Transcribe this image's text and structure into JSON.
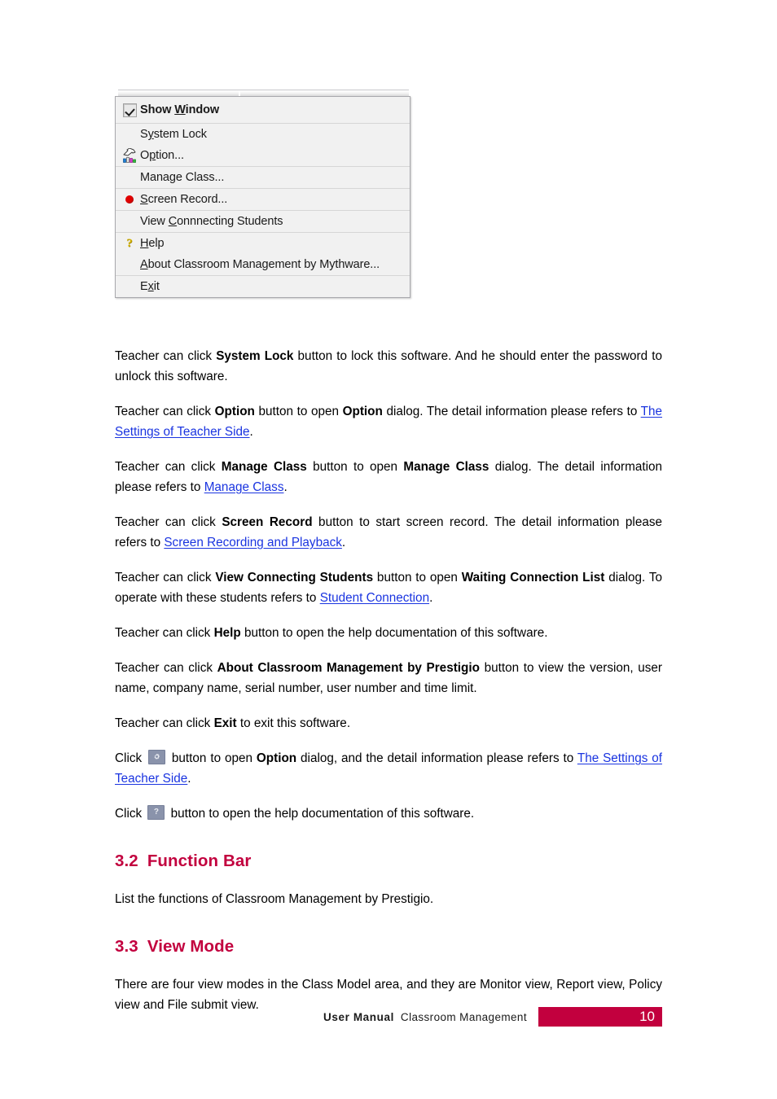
{
  "context_menu": {
    "groups": [
      {
        "items": [
          {
            "icon": "checkbox-checked-icon",
            "label_before": "Show ",
            "accel": "W",
            "label_after": "indow",
            "bold": true,
            "name": "menu-item-show-window"
          }
        ]
      },
      {
        "items": [
          {
            "icon": "none",
            "label_before": "S",
            "accel": "y",
            "label_after": "stem Lock",
            "bold": false,
            "name": "menu-item-system-lock"
          },
          {
            "icon": "tools-icon",
            "label_before": "O",
            "accel": "p",
            "label_after": "tion...",
            "bold": false,
            "name": "menu-item-option"
          }
        ]
      },
      {
        "items": [
          {
            "icon": "none",
            "label_before": "Mana",
            "accel": "g",
            "label_after": "e Class...",
            "bold": false,
            "name": "menu-item-manage-class"
          }
        ]
      },
      {
        "items": [
          {
            "icon": "record-dot-icon",
            "label_before": "",
            "accel": "S",
            "label_after": "creen Record...",
            "bold": false,
            "name": "menu-item-screen-record"
          }
        ]
      },
      {
        "items": [
          {
            "icon": "none",
            "label_before": "View ",
            "accel": "C",
            "label_after": "onnnecting Students",
            "bold": false,
            "name": "menu-item-view-connecting-students"
          }
        ]
      },
      {
        "items": [
          {
            "icon": "help-question-icon",
            "label_before": "",
            "accel": "H",
            "label_after": "elp",
            "bold": false,
            "name": "menu-item-help"
          },
          {
            "icon": "none",
            "label_before": "",
            "accel": "A",
            "label_after": "bout Classroom Management by Mythware...",
            "bold": false,
            "name": "menu-item-about"
          }
        ]
      },
      {
        "items": [
          {
            "icon": "none",
            "label_before": "E",
            "accel": "x",
            "label_after": "it",
            "bold": false,
            "name": "menu-item-exit"
          }
        ]
      }
    ]
  },
  "body": {
    "p1": {
      "t1": "Teacher can click ",
      "b1": "System Lock",
      "t2": " button to lock this software. And he should enter the password to unlock this software."
    },
    "p2": {
      "t1": "Teacher can click ",
      "b1": "Option",
      "t2": " button to open ",
      "b2": "Option",
      "t3": " dialog. The detail information please refers to ",
      "link": "The Settings of Teacher Side",
      "t4": "."
    },
    "p3": {
      "t1": "Teacher can click ",
      "b1": "Manage Class",
      "t2": " button to open ",
      "b2": "Manage Class",
      "t3": " dialog. The detail information please refers to ",
      "link": "Manage Class",
      "t4": "."
    },
    "p4": {
      "t1": "Teacher can click ",
      "b1": "Screen Record",
      "t2": " button to start screen record. The detail information please refers to ",
      "link": "Screen Recording and Playback",
      "t3": "."
    },
    "p5": {
      "t1": "Teacher can click ",
      "b1": "View Connecting Students",
      "t2": " button to open ",
      "b2": "Waiting Connection List",
      "t3": " dialog. To operate with these students refers to ",
      "link": "Student Connection",
      "t4": "."
    },
    "p6": {
      "t1": "Teacher can click ",
      "b1": "Help",
      "t2": " button to open the help documentation of this software."
    },
    "p7": {
      "t1": "Teacher can click ",
      "b1": "About Classroom Management by Prestigio",
      "t2": " button to view the version, user name, company name, serial number, user number and time limit."
    },
    "p8": {
      "t1": "Teacher can click ",
      "b1": "Exit",
      "t2": " to exit this software."
    },
    "p9": {
      "t1": "Click ",
      "icon": "settings-gear-icon",
      "t2": " button to open ",
      "b1": "Option",
      "t3": " dialog, and the detail information please refers to ",
      "link": "The Settings of Teacher Side",
      "t4": "."
    },
    "p10": {
      "t1": "Click ",
      "icon": "help-question-icon",
      "icon_glyph": "?",
      "t2": " button to open the help documentation of this software."
    }
  },
  "sections": [
    {
      "number": "3.2",
      "title": "Function Bar",
      "body": "List the functions of Classroom Management by Prestigio."
    },
    {
      "number": "3.3",
      "title": "View Mode",
      "body": "There are four view modes in the Class Model area, and they are Monitor view, Report view, Policy view and File submit view."
    }
  ],
  "footer": {
    "manual_label": "User  Manual",
    "doc_title": "Classroom  Management",
    "page_number": "10"
  },
  "colors": {
    "heading": "#C2003E",
    "link": "#1A34E0",
    "footer_bar": "#C2003E",
    "menu_bg": "#F1F1F1",
    "record_dot": "#E00000",
    "inline_button": "#8A93AB"
  }
}
